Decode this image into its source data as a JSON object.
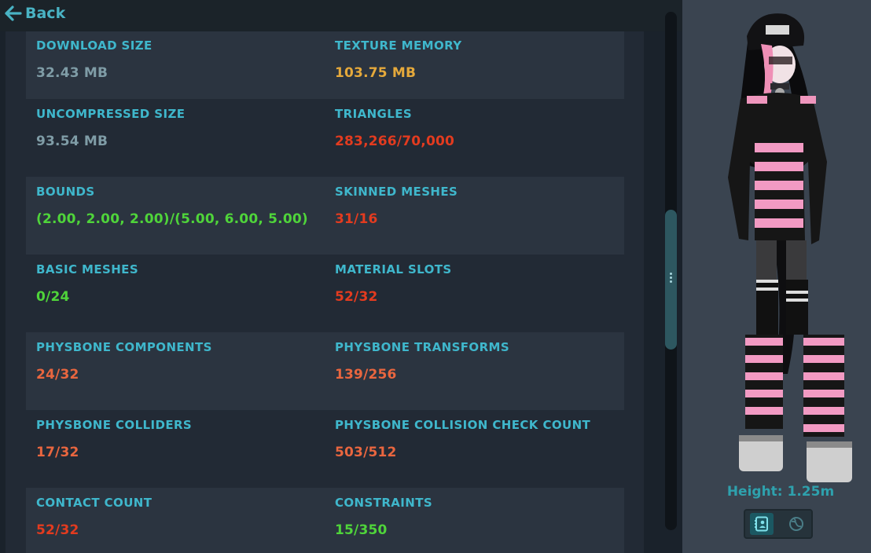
{
  "header": {
    "back_label": "Back",
    "back_icon": "arrow-left-icon"
  },
  "colors": {
    "label": "#3fb7cc",
    "neutral": "#7f9ca6",
    "warning": "#e5a93b",
    "bad": "#e33b1f",
    "poor": "#e9663f",
    "good": "#4fd43a"
  },
  "stats": [
    {
      "left": {
        "label": "DOWNLOAD SIZE",
        "value": "32.43 MB",
        "status": "neutral"
      },
      "right": {
        "label": "TEXTURE MEMORY",
        "value": "103.75 MB",
        "status": "warning"
      }
    },
    {
      "left": {
        "label": "UNCOMPRESSED SIZE",
        "value": "93.54 MB",
        "status": "neutral"
      },
      "right": {
        "label": "TRIANGLES",
        "value": "283,266/70,000",
        "status": "bad"
      }
    },
    {
      "left": {
        "label": "BOUNDS",
        "value": "(2.00, 2.00, 2.00)/(5.00, 6.00, 5.00)",
        "status": "good"
      },
      "right": {
        "label": "SKINNED MESHES",
        "value": "31/16",
        "status": "bad"
      }
    },
    {
      "left": {
        "label": "BASIC MESHES",
        "value": "0/24",
        "status": "good"
      },
      "right": {
        "label": "MATERIAL SLOTS",
        "value": "52/32",
        "status": "bad"
      }
    },
    {
      "left": {
        "label": "PHYSBONE COMPONENTS",
        "value": "24/32",
        "status": "poor"
      },
      "right": {
        "label": "PHYSBONE TRANSFORMS",
        "value": "139/256",
        "status": "poor"
      }
    },
    {
      "left": {
        "label": "PHYSBONE COLLIDERS",
        "value": "17/32",
        "status": "poor"
      },
      "right": {
        "label": "PHYSBONE COLLISION CHECK COUNT",
        "value": "503/512",
        "status": "poor"
      }
    },
    {
      "left": {
        "label": "CONTACT COUNT",
        "value": "52/32",
        "status": "bad"
      },
      "right": {
        "label": "CONSTRAINTS",
        "value": "15/350",
        "status": "good"
      }
    }
  ],
  "preview": {
    "height_label": "Height: 1.25m",
    "buttons": [
      {
        "icon": "contact-card-icon",
        "active": true
      },
      {
        "icon": "globe-icon",
        "active": false
      }
    ]
  }
}
